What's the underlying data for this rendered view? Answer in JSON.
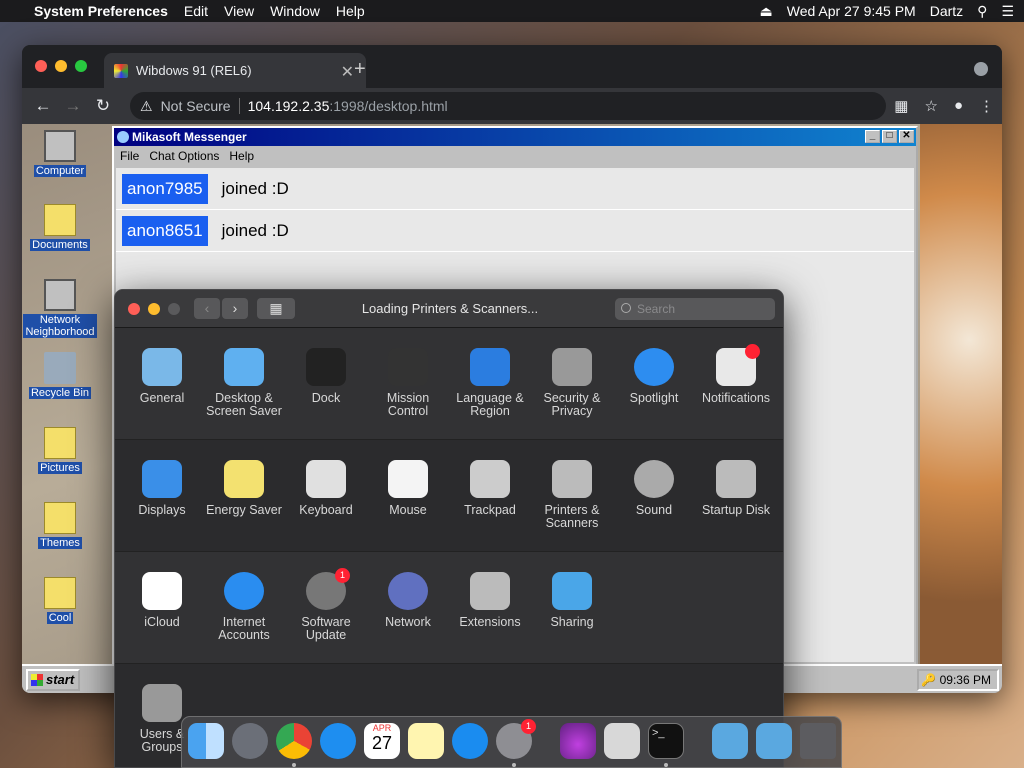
{
  "menubar": {
    "app": "System Preferences",
    "items": [
      "Edit",
      "View",
      "Window",
      "Help"
    ],
    "datetime": "Wed Apr 27  9:45 PM",
    "user": "Dartz"
  },
  "browser": {
    "tab_title": "Wibdows 91 (REL6)",
    "not_secure": "Not Secure",
    "url_host": "104.192.2.35",
    "url_path": ":1998/desktop.html"
  },
  "desktop": {
    "icons": [
      "Computer",
      "Documents",
      "Network Neighborhood",
      "Recycle Bin",
      "Pictures",
      "Themes",
      "Cool"
    ],
    "start": "start",
    "clock": "09:36 PM"
  },
  "messenger": {
    "title": "Mikasoft Messenger",
    "menu": [
      "File",
      "Chat Options",
      "Help"
    ],
    "messages": [
      {
        "user": "anon7985",
        "text": "joined :D"
      },
      {
        "user": "anon8651",
        "text": "joined :D"
      }
    ]
  },
  "sysprefs": {
    "title": "Loading Printers & Scanners...",
    "search_placeholder": "Search",
    "row1": [
      "General",
      "Desktop & Screen Saver",
      "Dock",
      "Mission Control",
      "Language & Region",
      "Security & Privacy",
      "Spotlight",
      "Notifications"
    ],
    "row2": [
      "Displays",
      "Energy Saver",
      "Keyboard",
      "Mouse",
      "Trackpad",
      "Printers & Scanners",
      "Sound",
      "Startup Disk"
    ],
    "row3": [
      "iCloud",
      "Internet Accounts",
      "Software Update",
      "Network",
      "Extensions",
      "Sharing"
    ],
    "row4": [
      "Users & Groups"
    ],
    "software_update_badge": "1"
  },
  "dock": {
    "calendar_month": "APR",
    "calendar_day": "27",
    "settings_badge": "1"
  }
}
